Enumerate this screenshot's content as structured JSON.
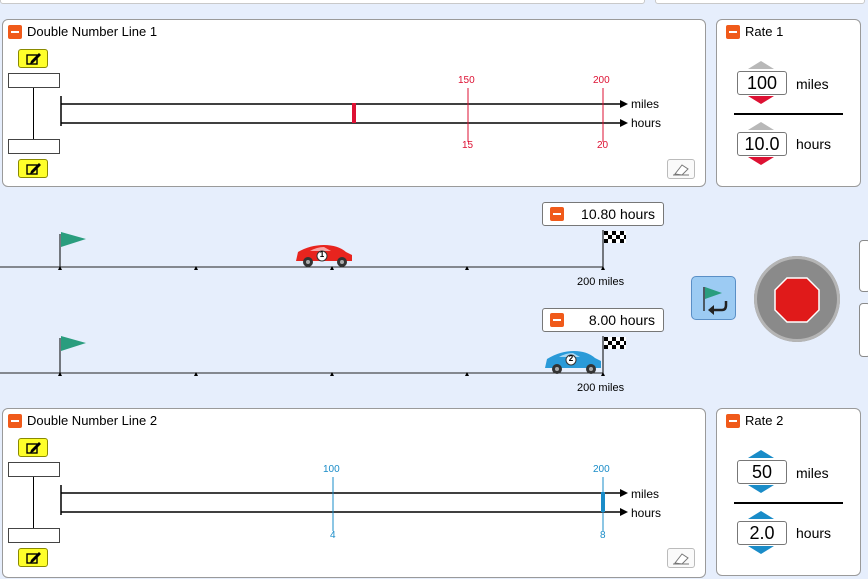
{
  "dnl1": {
    "title": "Double Number Line 1",
    "top_unit": "miles",
    "bottom_unit": "hours",
    "markers": [
      {
        "top": "150",
        "bottom": "15"
      },
      {
        "top": "200",
        "bottom": "20"
      }
    ],
    "color": "#dd1133"
  },
  "rate1": {
    "title": "Rate 1",
    "top_value": "100",
    "top_unit": "miles",
    "bottom_value": "10.0",
    "bottom_unit": "hours",
    "color": "#dd1133"
  },
  "race": {
    "track1": {
      "timer": "10.80 hours",
      "finish_label": "200 miles",
      "car_number": "1",
      "car_color": "#e8241e"
    },
    "track2": {
      "timer": "8.00 hours",
      "finish_label": "200 miles",
      "car_number": "2",
      "car_color": "#2a9ad8"
    }
  },
  "dnl2": {
    "title": "Double Number Line 2",
    "top_unit": "miles",
    "bottom_unit": "hours",
    "markers": [
      {
        "top": "100",
        "bottom": "4"
      },
      {
        "top": "200",
        "bottom": "8"
      }
    ],
    "color": "#1a8cc8"
  },
  "rate2": {
    "title": "Rate 2",
    "top_value": "50",
    "top_unit": "miles",
    "bottom_value": "2.0",
    "bottom_unit": "hours",
    "color": "#1a8cc8"
  },
  "icons": {
    "edit": "pencil-edit-icon",
    "eraser": "eraser-icon",
    "stop": "stop-icon",
    "reset": "return-flag-icon"
  }
}
